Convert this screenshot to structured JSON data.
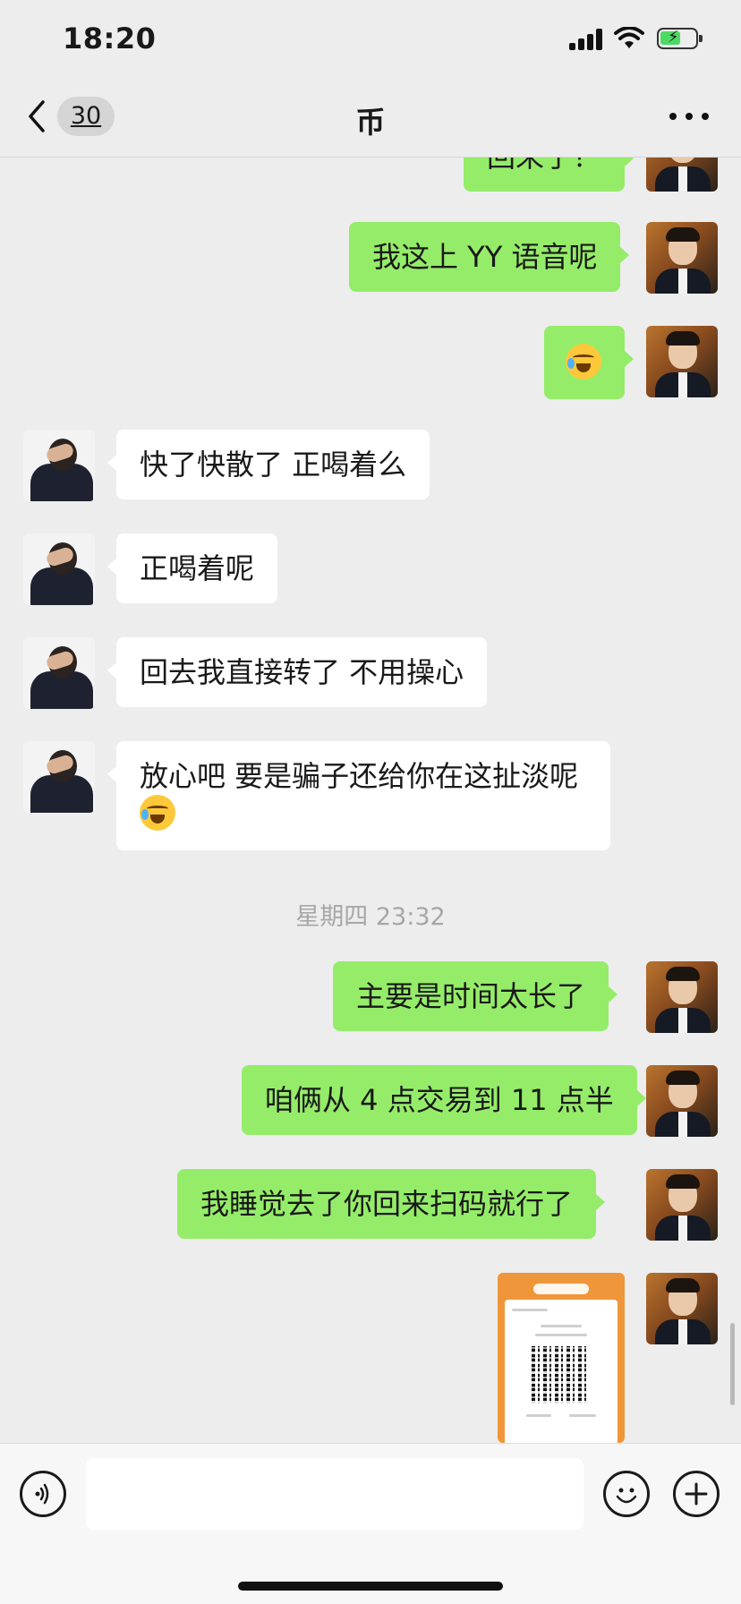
{
  "status_bar": {
    "time": "18:20"
  },
  "nav": {
    "unread_count": "30",
    "title": "币"
  },
  "messages": [
    {
      "side": "me",
      "text": "回来了？",
      "partial": true
    },
    {
      "side": "me",
      "text": "我这上 YY 语音呢"
    },
    {
      "side": "me",
      "text": "",
      "emoji": "crying-laughing"
    },
    {
      "side": "them",
      "text": "快了快散了  正喝着么"
    },
    {
      "side": "them",
      "text": "正喝着呢"
    },
    {
      "side": "them",
      "text": "回去我直接转了  不用操心"
    },
    {
      "side": "them",
      "text": "放心吧  要是骗子还给你在这扯淡呢",
      "emoji": "crying-laughing"
    },
    {
      "side": "me",
      "text": "主要是时间太长了"
    },
    {
      "side": "me",
      "text": "咱俩从 4 点交易到 11 点半"
    },
    {
      "side": "me",
      "text": "我睡觉去了你回来扫码就行了"
    },
    {
      "side": "me",
      "type": "image",
      "description": "payment-qr-screenshot"
    }
  ],
  "timestamp": "星期四 23:32",
  "input": {
    "value": ""
  },
  "colors": {
    "bubble_me": "#95ec69",
    "bubble_them": "#ffffff",
    "background": "#ededed"
  }
}
